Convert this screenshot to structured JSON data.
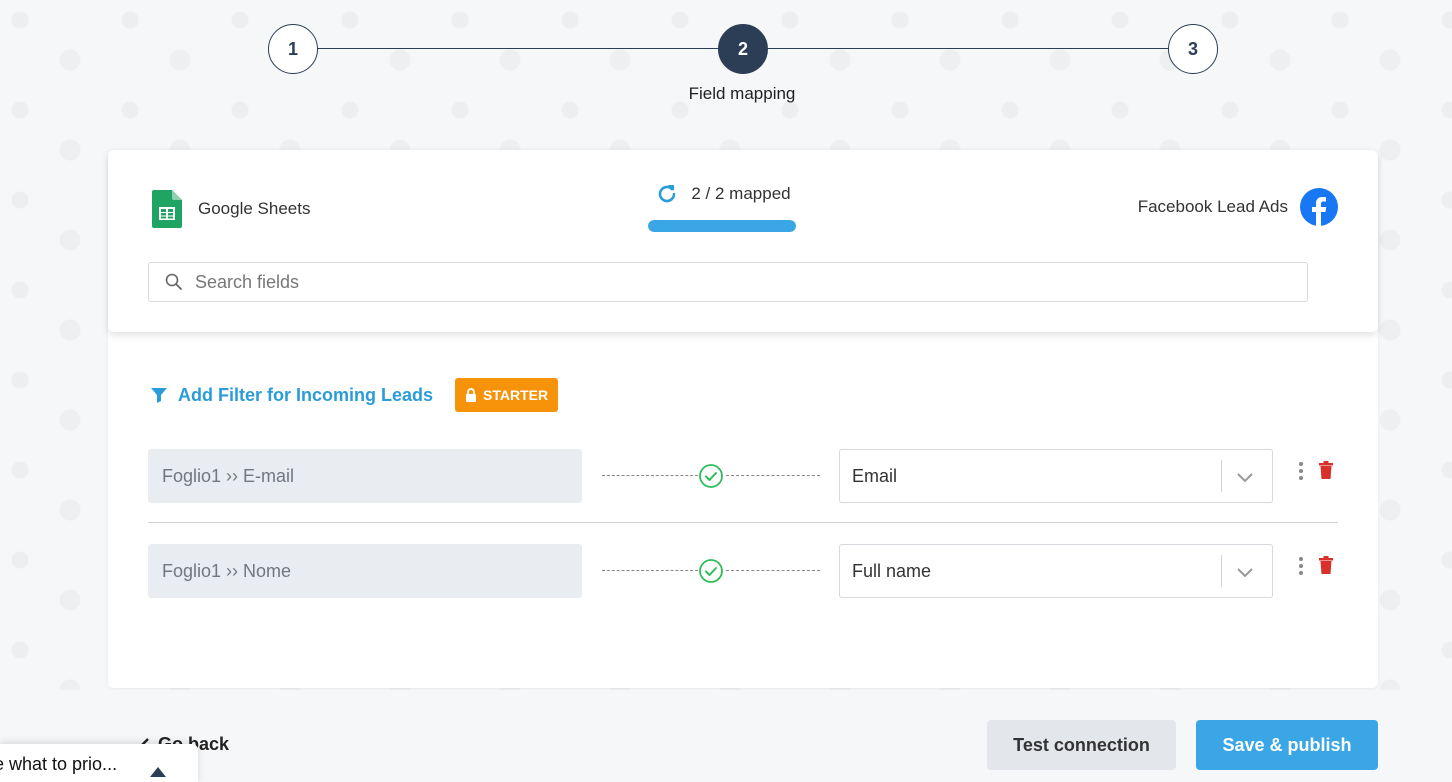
{
  "stepper": {
    "steps": [
      "1",
      "2",
      "3"
    ],
    "active_label": "Field mapping"
  },
  "mapping_header": {
    "source_app": "Google Sheets",
    "destination_app": "Facebook Lead Ads",
    "mapped_text": "2 / 2 mapped",
    "mapped_fraction": 1.0
  },
  "search": {
    "placeholder": "Search fields"
  },
  "filter": {
    "label": "Add Filter for Incoming Leads",
    "badge": "STARTER"
  },
  "mappings": [
    {
      "source": "Foglio1 ›› E-mail",
      "destination": "Email"
    },
    {
      "source": "Foglio1 ›› Nome",
      "destination": "Full name"
    }
  ],
  "footer": {
    "go_back": "Go back",
    "test_connection": "Test connection",
    "save_publish": "Save & publish"
  },
  "toast": {
    "text": "e what to prio..."
  },
  "colors": {
    "accent": "#3aa6e6",
    "dark": "#2c3e55",
    "badge": "#f7930a",
    "success": "#2ebd59",
    "danger": "#d9302c"
  },
  "icons": [
    "google-sheets-icon",
    "refresh-icon",
    "facebook-icon",
    "search-icon",
    "filter-icon",
    "lock-icon",
    "check-circle-icon",
    "chevron-down-icon",
    "kebab-icon",
    "trash-icon",
    "chevron-left-icon",
    "caret-up-icon"
  ]
}
